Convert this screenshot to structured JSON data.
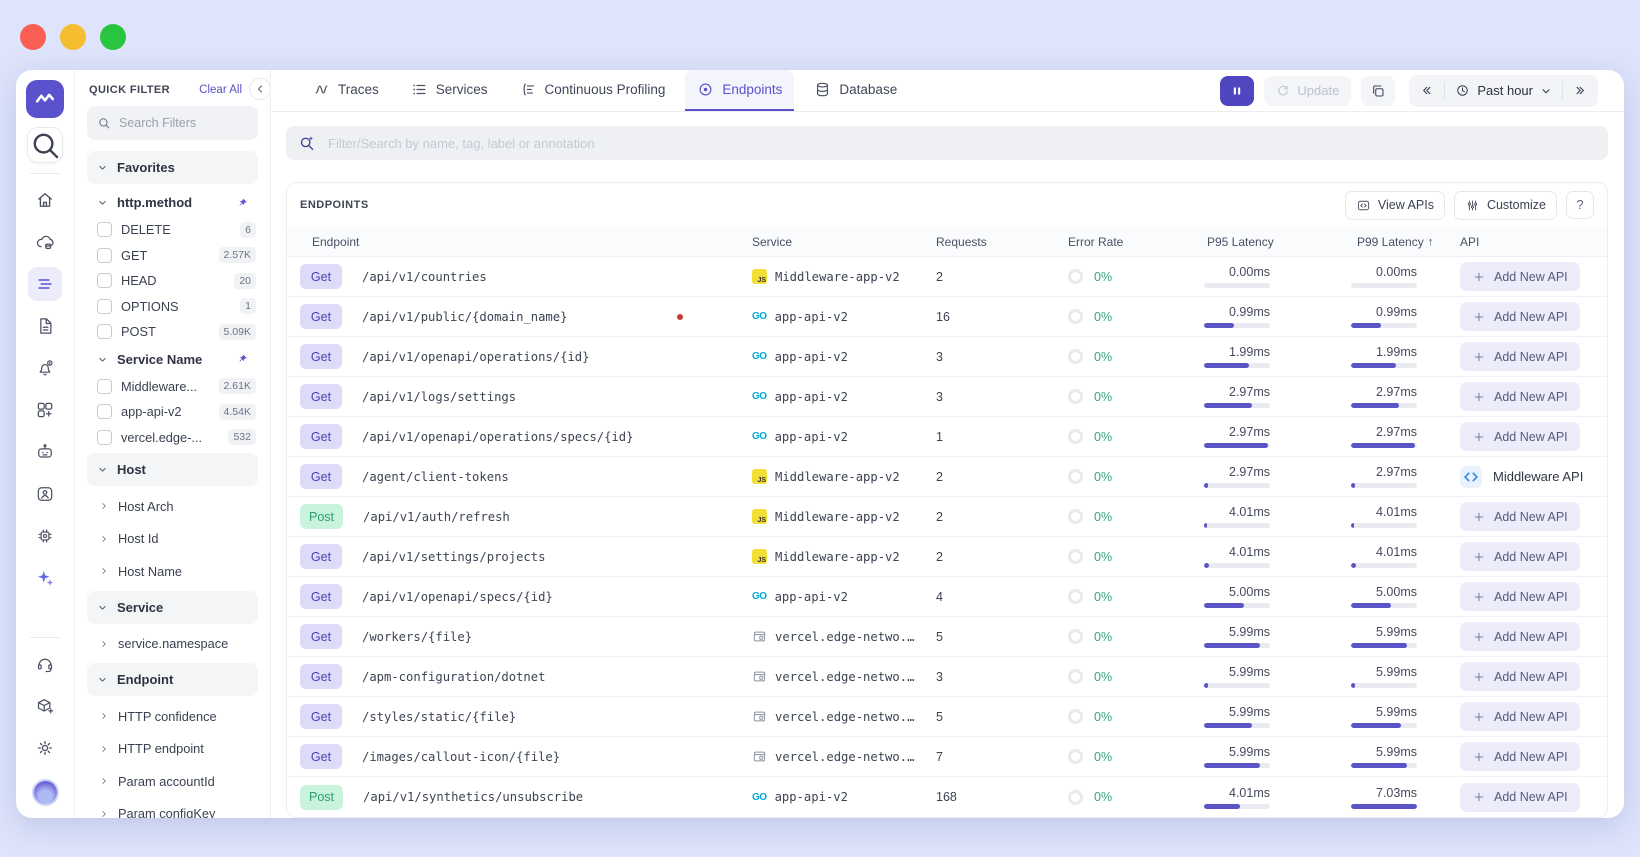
{
  "accent": "#5a51c9",
  "rail": {
    "top": [
      {
        "name": "app-logo",
        "icon": "logo",
        "type": "logo"
      },
      {
        "name": "rail-search-button",
        "icon": "search",
        "type": "search"
      },
      {
        "type": "divider"
      },
      {
        "name": "rail-home-button",
        "icon": "home"
      },
      {
        "name": "rail-infra-button",
        "icon": "cloud-db"
      },
      {
        "name": "rail-apm-button",
        "icon": "stagger-list",
        "active": true
      },
      {
        "name": "rail-logs-button",
        "icon": "document"
      },
      {
        "name": "rail-alerts-button",
        "icon": "bell-alert"
      },
      {
        "name": "rail-integrations-button",
        "icon": "grid-plus"
      },
      {
        "name": "rail-assistant-button",
        "icon": "robot"
      },
      {
        "name": "rail-rum-button",
        "icon": "person-box"
      },
      {
        "name": "rail-processes-button",
        "icon": "chip"
      },
      {
        "name": "rail-ai-button",
        "icon": "sparkle",
        "colored": true
      }
    ],
    "bottom": [
      {
        "name": "rail-support-button",
        "icon": "headset"
      },
      {
        "name": "rail-install-button",
        "icon": "box-plus"
      },
      {
        "name": "rail-settings-button",
        "icon": "gear"
      },
      {
        "name": "user-avatar",
        "type": "avatar"
      }
    ]
  },
  "quick_filter": {
    "title": "QUICK FILTER",
    "clear_all": "Clear All",
    "search_placeholder": "Search Filters",
    "items": [
      {
        "type": "section",
        "label": "Favorites"
      },
      {
        "type": "group",
        "label": "http.method",
        "pinned": true
      },
      {
        "type": "option",
        "label": "DELETE",
        "count": "6"
      },
      {
        "type": "option",
        "label": "GET",
        "count": "2.57K"
      },
      {
        "type": "option",
        "label": "HEAD",
        "count": "20"
      },
      {
        "type": "option",
        "label": "OPTIONS",
        "count": "1"
      },
      {
        "type": "option",
        "label": "POST",
        "count": "5.09K"
      },
      {
        "type": "group",
        "label": "Service Name",
        "pinned": true
      },
      {
        "type": "option",
        "label": "Middleware...",
        "count": "2.61K"
      },
      {
        "type": "option",
        "label": "app-api-v2",
        "count": "4.54K"
      },
      {
        "type": "option",
        "label": "vercel.edge-...",
        "count": "532"
      },
      {
        "type": "section",
        "label": "Host"
      },
      {
        "type": "item",
        "label": "Host Arch"
      },
      {
        "type": "item",
        "label": "Host Id"
      },
      {
        "type": "item",
        "label": "Host Name"
      },
      {
        "type": "section",
        "label": "Service"
      },
      {
        "type": "item",
        "label": "service.namespace"
      },
      {
        "type": "section",
        "label": "Endpoint"
      },
      {
        "type": "item",
        "label": "HTTP confidence"
      },
      {
        "type": "item",
        "label": "HTTP endpoint"
      },
      {
        "type": "item",
        "label": "Param accountId"
      },
      {
        "type": "item",
        "label": "Param configKey"
      }
    ]
  },
  "nav": {
    "tabs": [
      {
        "label": "Traces",
        "icon": "traces"
      },
      {
        "label": "Services",
        "icon": "services"
      },
      {
        "label": "Continuous Profiling",
        "icon": "profiling"
      },
      {
        "label": "Endpoints",
        "icon": "endpoints",
        "active": true
      },
      {
        "label": "Database",
        "icon": "database"
      }
    ],
    "controls": {
      "update_label": "Update",
      "time_range": "Past hour"
    }
  },
  "search_bar": {
    "placeholder": "Filter/Search by name, tag, label or annotation"
  },
  "endpoints_panel": {
    "title": "ENDPOINTS",
    "view_apis": "View APIs",
    "customize": "Customize",
    "help": "?"
  },
  "table": {
    "columns": [
      {
        "label": "Endpoint"
      },
      {
        "label": "Service"
      },
      {
        "label": "Requests"
      },
      {
        "label": "Error Rate"
      },
      {
        "label": "P95 Latency"
      },
      {
        "label": "P99 Latency",
        "sort": "asc"
      },
      {
        "label": "API"
      }
    ],
    "service_icon_text": {
      "nodejs": "JS",
      "go": "GO"
    },
    "add_api_label": "Add New API",
    "middleware_api_label": "Middleware API",
    "rows": [
      {
        "method": "Get",
        "path": "/api/v1/countries",
        "service": "Middleware-app-v2",
        "service_icon": "nodejs",
        "requests": "2",
        "error_rate": "0%",
        "p95": "0.00ms",
        "p95_pct": 0,
        "p99": "0.00ms",
        "p99_pct": 0,
        "api": "add"
      },
      {
        "method": "Get",
        "path": "/api/v1/public/{domain_name}",
        "service": "app-api-v2",
        "service_icon": "go",
        "requests": "16",
        "error_rate": "0%",
        "p95": "0.99ms",
        "p95_pct": 45,
        "p99": "0.99ms",
        "p99_pct": 45,
        "api": "add",
        "alert_dot": true
      },
      {
        "method": "Get",
        "path": "/api/v1/openapi/operations/{id}",
        "service": "app-api-v2",
        "service_icon": "go",
        "requests": "3",
        "error_rate": "0%",
        "p95": "1.99ms",
        "p95_pct": 68,
        "p99": "1.99ms",
        "p99_pct": 68,
        "api": "add"
      },
      {
        "method": "Get",
        "path": "/api/v1/logs/settings",
        "service": "app-api-v2",
        "service_icon": "go",
        "requests": "3",
        "error_rate": "0%",
        "p95": "2.97ms",
        "p95_pct": 73,
        "p99": "2.97ms",
        "p99_pct": 73,
        "api": "add"
      },
      {
        "method": "Get",
        "path": "/api/v1/openapi/operations/specs/{id}",
        "service": "app-api-v2",
        "service_icon": "go",
        "requests": "1",
        "error_rate": "0%",
        "p95": "2.97ms",
        "p95_pct": 97,
        "p99": "2.97ms",
        "p99_pct": 97,
        "api": "add"
      },
      {
        "method": "Get",
        "path": "/agent/client-tokens",
        "service": "Middleware-app-v2",
        "service_icon": "nodejs",
        "requests": "2",
        "error_rate": "0%",
        "p95": "2.97ms",
        "p95_pct": 6,
        "p99": "2.97ms",
        "p99_pct": 6,
        "api": "middleware"
      },
      {
        "method": "Post",
        "path": "/api/v1/auth/refresh",
        "service": "Middleware-app-v2",
        "service_icon": "nodejs",
        "requests": "2",
        "error_rate": "0%",
        "p95": "4.01ms",
        "p95_pct": 5,
        "p99": "4.01ms",
        "p99_pct": 5,
        "api": "add"
      },
      {
        "method": "Get",
        "path": "/api/v1/settings/projects",
        "service": "Middleware-app-v2",
        "service_icon": "nodejs",
        "requests": "2",
        "error_rate": "0%",
        "p95": "4.01ms",
        "p95_pct": 8,
        "p99": "4.01ms",
        "p99_pct": 8,
        "api": "add"
      },
      {
        "method": "Get",
        "path": "/api/v1/openapi/specs/{id}",
        "service": "app-api-v2",
        "service_icon": "go",
        "requests": "4",
        "error_rate": "0%",
        "p95": "5.00ms",
        "p95_pct": 60,
        "p99": "5.00ms",
        "p99_pct": 60,
        "api": "add"
      },
      {
        "method": "Get",
        "path": "/workers/{file}",
        "service": "vercel.edge-netwo...",
        "service_icon": "edge",
        "requests": "5",
        "error_rate": "0%",
        "p95": "5.99ms",
        "p95_pct": 85,
        "p99": "5.99ms",
        "p99_pct": 85,
        "api": "add"
      },
      {
        "method": "Get",
        "path": "/apm-configuration/dotnet",
        "service": "vercel.edge-netwo...",
        "service_icon": "edge",
        "requests": "3",
        "error_rate": "0%",
        "p95": "5.99ms",
        "p95_pct": 6,
        "p99": "5.99ms",
        "p99_pct": 6,
        "api": "add"
      },
      {
        "method": "Get",
        "path": "/styles/static/{file}",
        "service": "vercel.edge-netwo...",
        "service_icon": "edge",
        "requests": "5",
        "error_rate": "0%",
        "p95": "5.99ms",
        "p95_pct": 73,
        "p99": "5.99ms",
        "p99_pct": 75,
        "api": "add"
      },
      {
        "method": "Get",
        "path": "/images/callout-icon/{file}",
        "service": "vercel.edge-netwo...",
        "service_icon": "edge",
        "requests": "7",
        "error_rate": "0%",
        "p95": "5.99ms",
        "p95_pct": 85,
        "p99": "5.99ms",
        "p99_pct": 85,
        "api": "add"
      },
      {
        "method": "Post",
        "path": "/api/v1/synthetics/unsubscribe",
        "service": "app-api-v2",
        "service_icon": "go",
        "requests": "168",
        "error_rate": "0%",
        "p95": "4.01ms",
        "p95_pct": 55,
        "p99": "7.03ms",
        "p99_pct": 100,
        "api": "add"
      }
    ]
  }
}
